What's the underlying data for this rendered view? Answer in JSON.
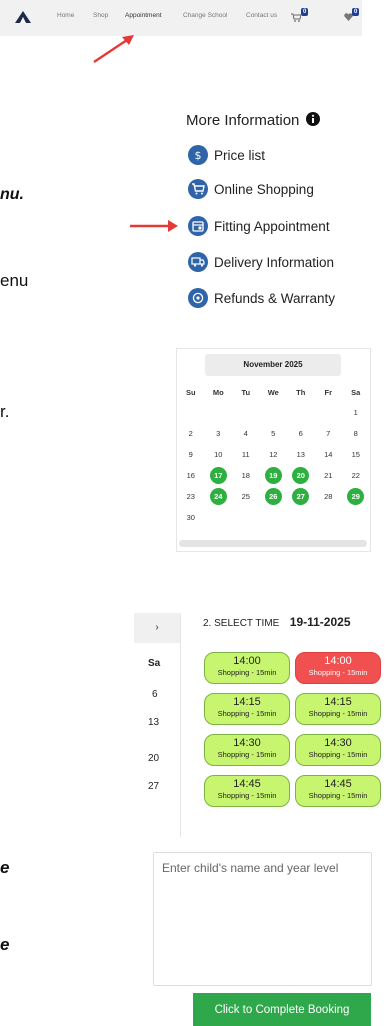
{
  "nav": {
    "links": [
      "Home",
      "Shop",
      "Appointment",
      "Change School",
      "Contact us"
    ],
    "cart_count": "0",
    "wishlist_count": "0"
  },
  "fragments": {
    "nu": "nu.",
    "enu": "enu",
    "r": "r.",
    "e1": "e",
    "e2": "e"
  },
  "info": {
    "title": "More Information",
    "items": [
      {
        "label": "Price list",
        "icon": "dollar-icon"
      },
      {
        "label": "Online Shopping",
        "icon": "cart-icon"
      },
      {
        "label": "Fitting Appointment",
        "icon": "calendar-icon"
      },
      {
        "label": "Delivery Information",
        "icon": "truck-icon"
      },
      {
        "label": "Refunds & Warranty",
        "icon": "refund-icon"
      }
    ]
  },
  "calendar": {
    "month": "November 2025",
    "days": [
      "Su",
      "Mo",
      "Tu",
      "We",
      "Th",
      "Fr",
      "Sa"
    ],
    "weeks": [
      [
        "",
        "",
        "",
        "",
        "",
        "",
        "1"
      ],
      [
        "2",
        "3",
        "4",
        "5",
        "6",
        "7",
        "8"
      ],
      [
        "9",
        "10",
        "11",
        "12",
        "13",
        "14",
        "15"
      ],
      [
        "16",
        "17",
        "18",
        "19",
        "20",
        "21",
        "22"
      ],
      [
        "23",
        "24",
        "25",
        "26",
        "27",
        "28",
        "29"
      ],
      [
        "30",
        "",
        "",
        "",
        "",
        "",
        ""
      ]
    ],
    "available": [
      "17",
      "19",
      "20",
      "24",
      "26",
      "27",
      "29"
    ]
  },
  "prev_calendar": {
    "nav_label": "›",
    "day_header": "Sa",
    "dates": [
      "6",
      "13",
      "20",
      "27"
    ]
  },
  "time": {
    "heading": "2. SELECT TIME",
    "date": "19-11-2025",
    "slots": [
      {
        "time": "14:00",
        "label": "Shopping - 15min",
        "status": "available"
      },
      {
        "time": "14:00",
        "label": "Shopping - 15min",
        "status": "taken"
      },
      {
        "time": "14:15",
        "label": "Shopping - 15min",
        "status": "available"
      },
      {
        "time": "14:15",
        "label": "Shopping - 15min",
        "status": "available"
      },
      {
        "time": "14:30",
        "label": "Shopping - 15min",
        "status": "available"
      },
      {
        "time": "14:30",
        "label": "Shopping - 15min",
        "status": "available"
      },
      {
        "time": "14:45",
        "label": "Shopping - 15min",
        "status": "available"
      },
      {
        "time": "14:45",
        "label": "Shopping - 15min",
        "status": "available"
      }
    ]
  },
  "form": {
    "placeholder": "Enter child's name and year level",
    "submit_label": "Click to Complete Booking"
  },
  "colors": {
    "accent_green": "#2eb040",
    "slot_green": "#c8f570",
    "slot_taken": "#f05050",
    "icon_blue": "#2f64a8",
    "arrow_red": "#e53935"
  }
}
